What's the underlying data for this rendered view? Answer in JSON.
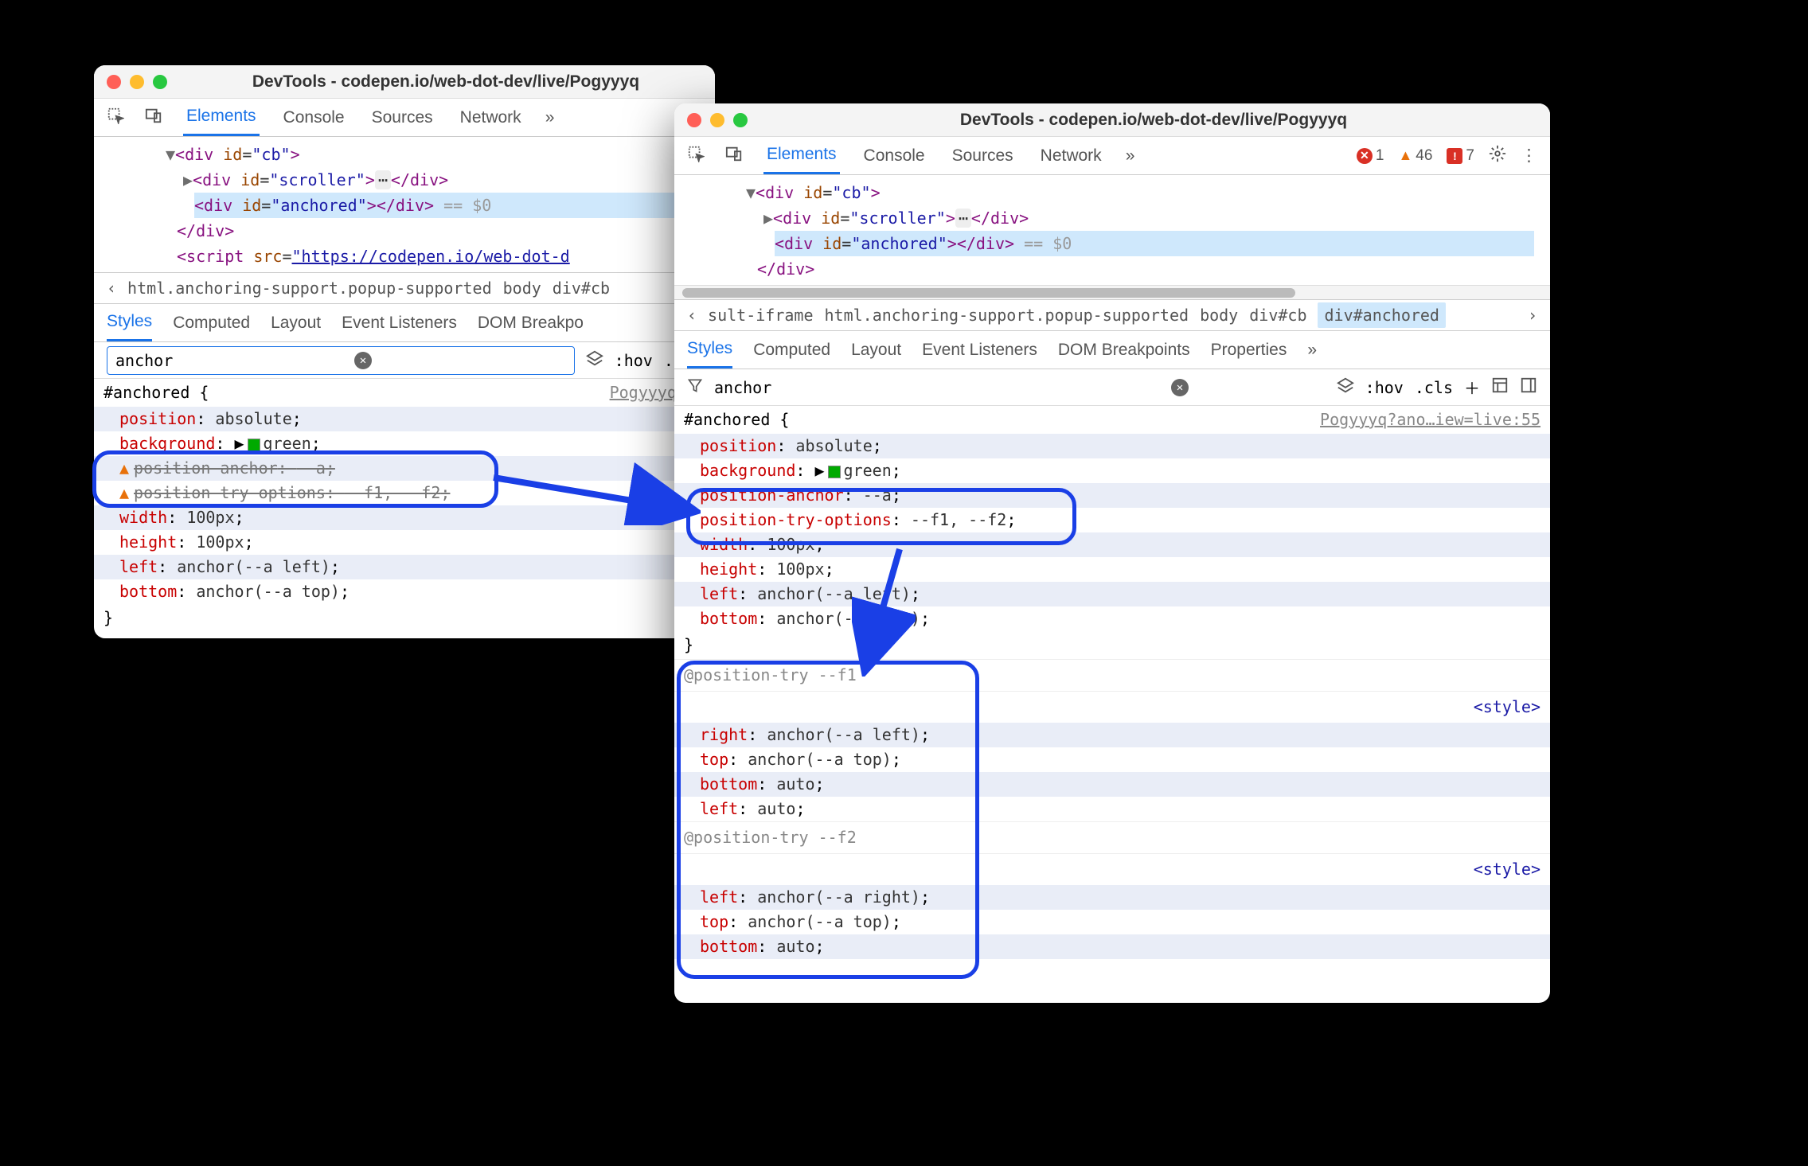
{
  "title": "DevTools - codepen.io/web-dot-dev/live/Pogyyyq",
  "tabs": [
    "Elements",
    "Console",
    "Sources",
    "Network"
  ],
  "styletabs1": [
    "Styles",
    "Computed",
    "Layout",
    "Event Listeners",
    "DOM Breakpo"
  ],
  "styletabs2": [
    "Styles",
    "Computed",
    "Layout",
    "Event Listeners",
    "DOM Breakpoints",
    "Properties"
  ],
  "filter": "anchor",
  "hov": ":hov",
  "cls": ".cls",
  "err": {
    "e": "1",
    "w": "46",
    "i": "7"
  },
  "crumbs1": [
    "html.anchoring-support.popup-supported",
    "body",
    "div#cb"
  ],
  "crumbs2": [
    "sult-iframe",
    "html.anchoring-support.popup-supported",
    "body",
    "div#cb",
    "div#anchored"
  ],
  "selector": "#anchored",
  "src1": "Pogyyyq?an",
  "src2": "Pogyyyq?ano…iew=live:55",
  "styletag": "<style>",
  "dom": {
    "l1a": "<div",
    "l1b": " id",
    "l1c": "\"cb\"",
    "l1d": ">",
    "l2a": "<div",
    "l2b": " id",
    "l2c": "\"scroller\"",
    "l2d": ">",
    "l2e": "</div>",
    "l3a": "<div",
    "l3b": " id",
    "l3c": "\"anchored\"",
    "l3d": ">",
    "l3e": "</div>",
    "l3f": " == $0",
    "l4": "</div>",
    "l5a": "<script",
    "l5b": " src",
    "l5c": "\"https://codepen.io/web-dot-d"
  },
  "rules": {
    "position": "position",
    "absolute": "absolute",
    "background": "background",
    "green": "green",
    "positionanchor": "position-anchor",
    "a": "--a",
    "positiontry": "position-try-options",
    "f1f2": "--f1, --f2",
    "width": "width",
    "h100": "100px",
    "height": "height",
    "left": "left",
    "anchorleft": "anchor(--a left)",
    "bottom": "bottom",
    "anchortop": "anchor(--a top)",
    "right": "right",
    "top": "top",
    "auto": "auto",
    "anchorright": "anchor(--a right)"
  },
  "at1": "@position-try --f1",
  "at2": "@position-try --f2"
}
